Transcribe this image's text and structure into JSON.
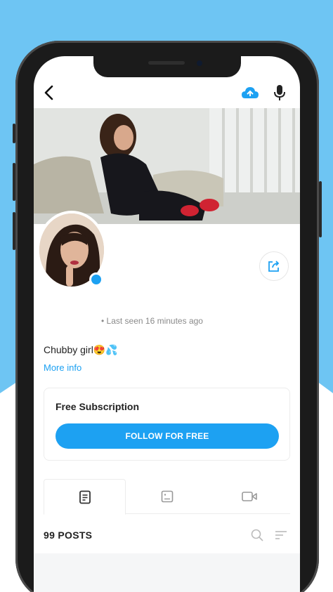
{
  "profile": {
    "last_seen": "• Last seen 16 minutes ago",
    "bio": "Chubby girl😍💦",
    "more_info": "More info"
  },
  "subscription": {
    "title": "Free Subscription",
    "follow_label": "FOLLOW FOR FREE"
  },
  "tabs": [
    {
      "name": "posts-tab",
      "icon": "document-icon",
      "active": true
    },
    {
      "name": "media-tab",
      "icon": "image-icon",
      "active": false
    },
    {
      "name": "video-tab",
      "icon": "video-icon",
      "active": false
    }
  ],
  "feed": {
    "posts_count": "99 POSTS"
  },
  "icons": {
    "back": "chevron-left-icon",
    "cloud": "cloud-upload-icon",
    "mic": "microphone-icon",
    "share": "share-icon",
    "search": "search-icon",
    "filter": "filter-icon"
  },
  "colors": {
    "accent": "#1da1f2",
    "background": "#6ec5f3",
    "phone": "#1b1b1b"
  }
}
